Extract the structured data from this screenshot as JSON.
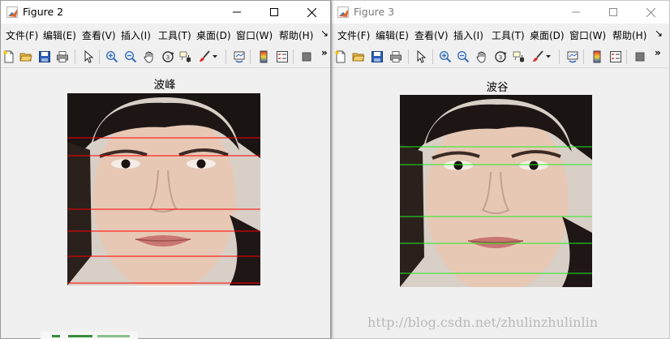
{
  "figure2": {
    "title": "Figure 2",
    "menu": [
      "文件(F)",
      "编辑(E)",
      "查看(V)",
      "插入(I)",
      "工具(T)",
      "桌面(D)",
      "窗口(W)",
      "帮助(H)"
    ],
    "menu_overflow": "↘",
    "toolbar_overflow": "»",
    "axes_title": "波峰",
    "line_color": "#ff0000"
  },
  "figure3": {
    "title": "Figure 3",
    "menu": [
      "文件(F)",
      "编辑(E)",
      "查看(V)",
      "插入(I)",
      "工具(T)",
      "桌面(D)",
      "窗口(W)",
      "帮助(H)"
    ],
    "menu_overflow": "↘",
    "toolbar_overflow": "»",
    "axes_title": "波谷",
    "line_color": "#22ee22"
  },
  "toolbar_icons": [
    "new-file-icon",
    "open-folder-icon",
    "save-icon",
    "print-icon",
    "select-pointer-icon",
    "zoom-in-icon",
    "zoom-out-icon",
    "pan-hand-icon",
    "rotate-3d-icon",
    "data-cursor-icon",
    "brush-icon",
    "link-plot-icon",
    "colorbar-icon",
    "legend-icon",
    "hide-plot-tools-icon"
  ],
  "watermark": "http://blog.csdn.net/zhulinzhulinlin"
}
